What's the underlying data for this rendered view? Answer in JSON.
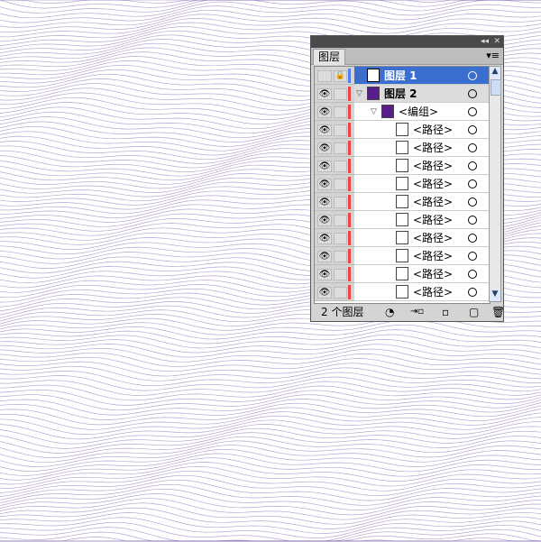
{
  "panel": {
    "title_controls": {
      "collapse": "◂◂",
      "close": "✕"
    },
    "tab": "图层",
    "menu_icon": "panel-menu-icon",
    "layers": [
      {
        "name": "图层 1",
        "selected": true,
        "visible": false,
        "locked": true,
        "color": "#4f7fe8",
        "expanded": false,
        "level": 0
      },
      {
        "name": "图层 2",
        "selected": false,
        "visible": true,
        "locked": false,
        "color": "#ee4444",
        "expanded": true,
        "level": 0
      },
      {
        "name": "<编组>",
        "visible": true,
        "color": "#ee4444",
        "expanded": true,
        "level": 1
      },
      {
        "name": "<路径>",
        "visible": true,
        "color": "#ee4444",
        "level": 2
      },
      {
        "name": "<路径>",
        "visible": true,
        "color": "#ee4444",
        "level": 2
      },
      {
        "name": "<路径>",
        "visible": true,
        "color": "#ee4444",
        "level": 2
      },
      {
        "name": "<路径>",
        "visible": true,
        "color": "#ee4444",
        "level": 2
      },
      {
        "name": "<路径>",
        "visible": true,
        "color": "#ee4444",
        "level": 2
      },
      {
        "name": "<路径>",
        "visible": true,
        "color": "#ee4444",
        "level": 2
      },
      {
        "name": "<路径>",
        "visible": true,
        "color": "#ee4444",
        "level": 2
      },
      {
        "name": "<路径>",
        "visible": true,
        "color": "#ee4444",
        "level": 2
      },
      {
        "name": "<路径>",
        "visible": true,
        "color": "#ee4444",
        "level": 2
      },
      {
        "name": "<路径>",
        "visible": true,
        "color": "#ee4444",
        "level": 2
      }
    ],
    "footer": {
      "count": "2 个图层"
    },
    "colors": {
      "selection": "#3b6fcf",
      "line": "#7b5cab",
      "group_thumb": "#5a1e8c"
    }
  }
}
